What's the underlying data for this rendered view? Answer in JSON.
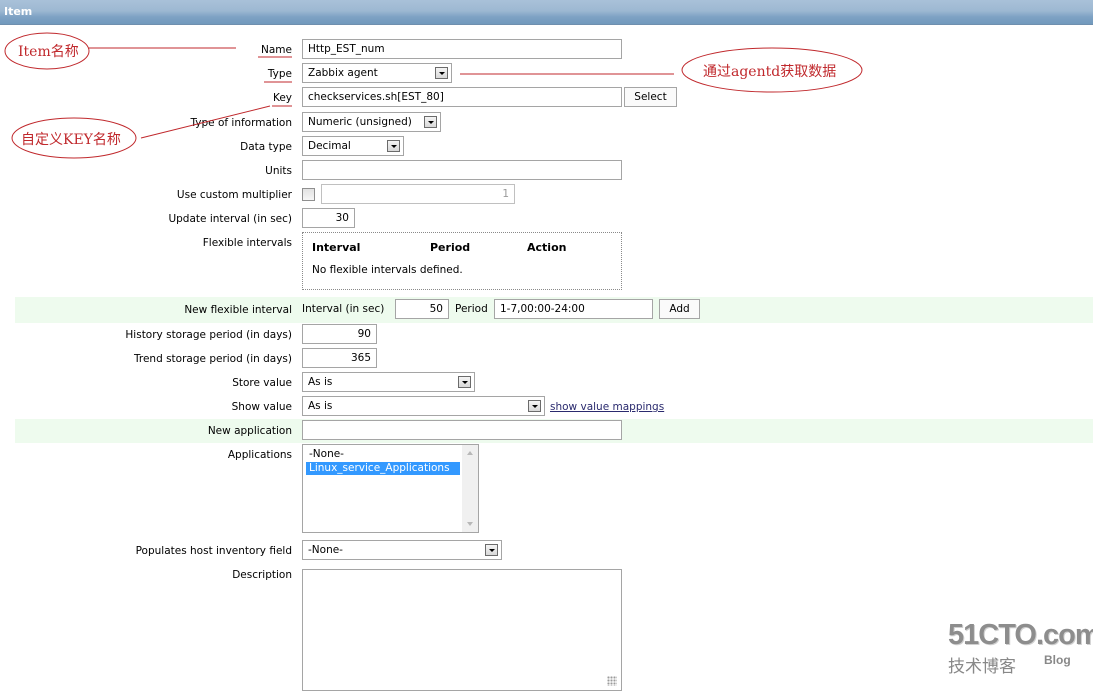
{
  "header": {
    "title": "Item"
  },
  "form": {
    "name": {
      "label": "Name",
      "value": "Http_EST_num"
    },
    "type": {
      "label": "Type",
      "value": "Zabbix agent"
    },
    "key": {
      "label": "Key",
      "value": "checkservices.sh[EST_80]",
      "select_button": "Select"
    },
    "type_of_information": {
      "label": "Type of information",
      "value": "Numeric (unsigned)"
    },
    "data_type": {
      "label": "Data type",
      "value": "Decimal"
    },
    "units": {
      "label": "Units",
      "value": ""
    },
    "custom_multiplier": {
      "label": "Use custom multiplier",
      "checked": false,
      "value": "1"
    },
    "update_interval": {
      "label": "Update interval (in sec)",
      "value": "30"
    },
    "flexible_intervals": {
      "label": "Flexible intervals",
      "columns": [
        "Interval",
        "Period",
        "Action"
      ],
      "empty_text": "No flexible intervals defined."
    },
    "new_flexible_interval": {
      "label": "New flexible interval",
      "interval_label": "Interval (in sec)",
      "interval_value": "50",
      "period_label": "Period",
      "period_value": "1-7,00:00-24:00",
      "add_button": "Add"
    },
    "history": {
      "label": "History storage period (in days)",
      "value": "90"
    },
    "trend": {
      "label": "Trend storage period (in days)",
      "value": "365"
    },
    "store_value": {
      "label": "Store value",
      "value": "As is"
    },
    "show_value": {
      "label": "Show value",
      "value": "As is",
      "link": "show value mappings"
    },
    "new_application": {
      "label": "New application",
      "value": ""
    },
    "applications": {
      "label": "Applications",
      "options": [
        "-None-",
        "Linux_service_Applications"
      ],
      "selected": "Linux_service_Applications"
    },
    "inventory_field": {
      "label": "Populates host inventory field",
      "value": "-None-"
    },
    "description": {
      "label": "Description",
      "value": ""
    }
  },
  "annotations": {
    "item_name": "Item名称",
    "agentd": "通过agentd获取数据",
    "key_name": "自定义KEY名称",
    "color": "#c0282c"
  },
  "watermark": {
    "line1": "51CTO.com",
    "line2": "技术博客",
    "line3": "Blog"
  }
}
